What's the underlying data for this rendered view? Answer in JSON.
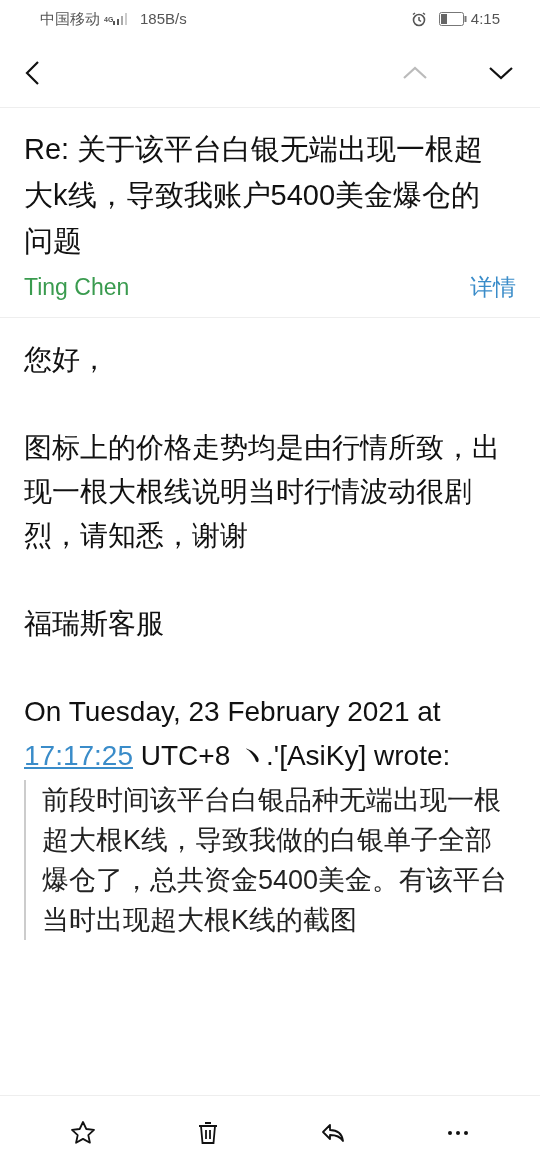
{
  "status_bar": {
    "carrier": "中国移动",
    "network": "4G",
    "speed": "185B/s",
    "time": "4:15"
  },
  "nav": {
    "previous_enabled": false,
    "next_enabled": true
  },
  "email": {
    "subject": "Re: 关于该平台白银无端出现一根超大k线，导致我账户5400美金爆仓的问题",
    "sender": "Ting Chen",
    "details_link": "详情",
    "body": [
      "您好，",
      "图标上的价格走势均是由行情所致，出现一根大根线说明当时行情波动很剧烈，请知悉，谢谢",
      "福瑞斯客服"
    ],
    "quote_header": {
      "before": "On Tuesday, 23 February 2021 at",
      "time_link": "17:17:25",
      "after": "UTC+8 ヽ.'[AsiKy] wrote:"
    },
    "quote": "前段时间该平台白银品种无端出现一根超大根K线，导致我做的白银单子全部爆仓了，总共资金5400美金。有该平台当时出现超大根K线的截图"
  },
  "toolbar": [
    {
      "kind": "star"
    },
    {
      "kind": "delete"
    },
    {
      "kind": "reply"
    },
    {
      "kind": "more"
    }
  ]
}
